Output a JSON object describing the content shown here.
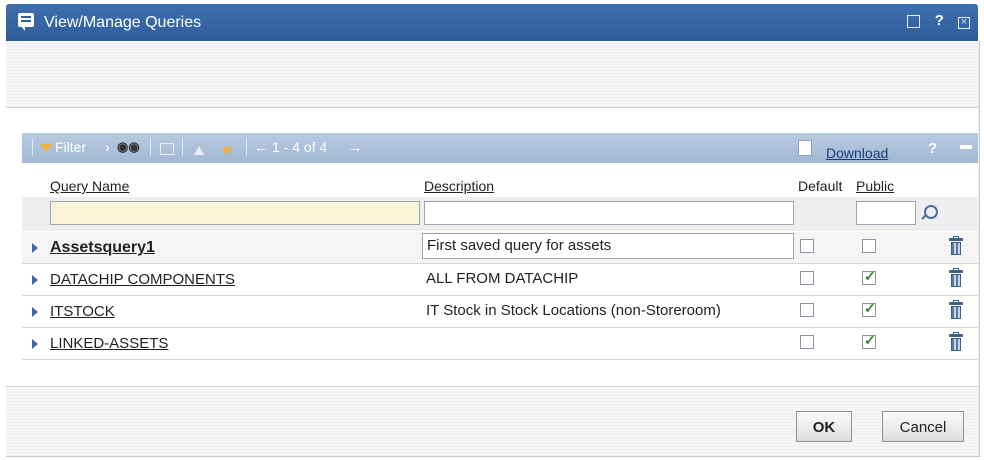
{
  "window": {
    "title": "View/Manage Queries",
    "help_label": "?"
  },
  "toolbar": {
    "filter_label": "Filter",
    "pagination": "1 - 4 of 4",
    "download_label": "Download",
    "help_label": "?"
  },
  "columns": {
    "query_name": "Query Name",
    "description": "Description",
    "default": "Default",
    "public": "Public"
  },
  "filters": {
    "query_name": "",
    "description": "",
    "public": ""
  },
  "rows": [
    {
      "name": "Assetsquery1",
      "description": "First saved query for assets",
      "default": false,
      "public": false
    },
    {
      "name": "DATACHIP COMPONENTS",
      "description": "ALL FROM DATACHIP",
      "default": false,
      "public": true
    },
    {
      "name": "ITSTOCK",
      "description": "IT Stock in Stock Locations (non-Storeroom)",
      "default": false,
      "public": true
    },
    {
      "name": "LINKED-ASSETS",
      "description": "",
      "default": false,
      "public": true
    }
  ],
  "buttons": {
    "ok": "OK",
    "cancel": "Cancel"
  },
  "colors": {
    "titlebar": "#2f5d9c",
    "toolbar": "#a2b8d3",
    "filter_input_bg": "#f9f4d8",
    "check": "#2e8a2e"
  }
}
